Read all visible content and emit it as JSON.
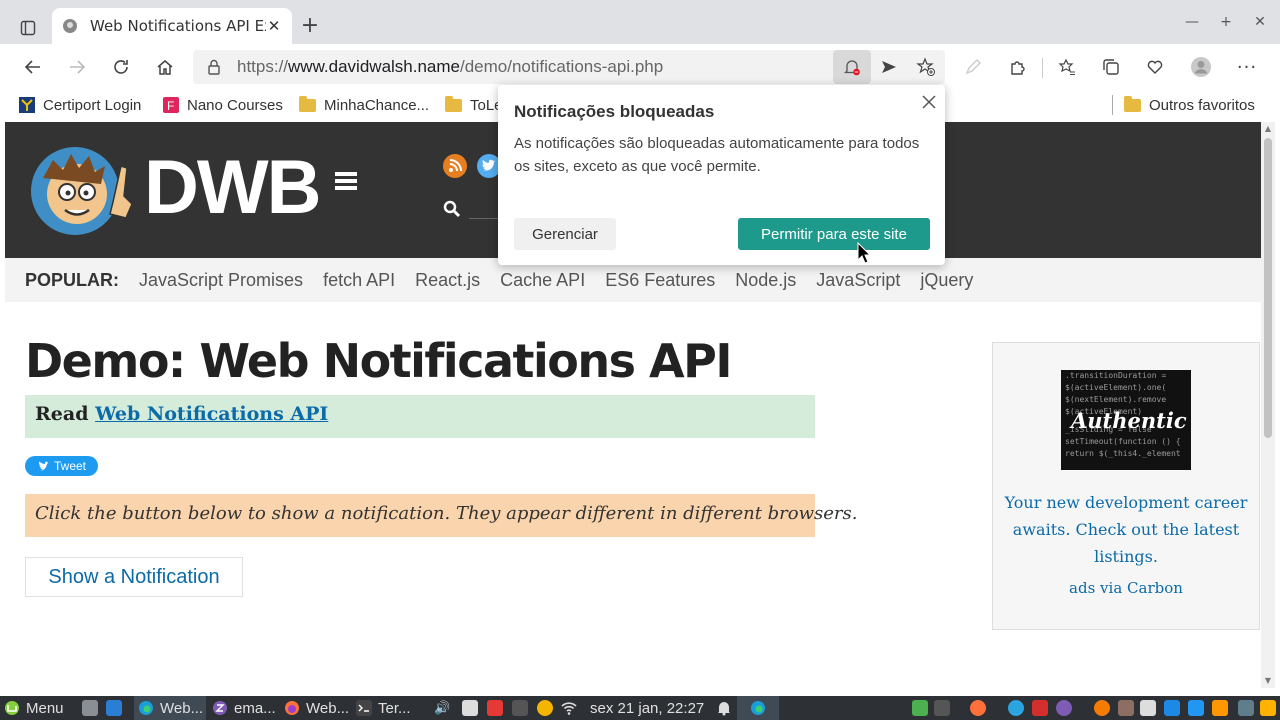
{
  "browser": {
    "tab_title": "Web Notifications API Ex",
    "url_scheme": "https://",
    "url_host": "www.davidwalsh.name",
    "url_path": "/demo/notifications-api.php",
    "bookmarks": [
      {
        "label": "Certiport Login",
        "icon": "certiport-icon"
      },
      {
        "label": "Nano Courses",
        "icon": "nano-courses-icon"
      },
      {
        "label": "MinhaChance...",
        "icon": "folder-icon"
      },
      {
        "label": "ToLe",
        "icon": "folder-icon"
      }
    ],
    "other_favorites": "Outros favoritos"
  },
  "popup": {
    "title": "Notificações bloqueadas",
    "body": "As notificações são bloqueadas automaticamente para todos os sites, exceto as que você permite.",
    "manage_label": "Gerenciar",
    "allow_label": "Permitir para este site"
  },
  "site": {
    "logo_text": "DWB",
    "popular_label": "POPULAR:",
    "popular_links": [
      "JavaScript Promises",
      "fetch API",
      "React.js",
      "Cache API",
      "ES6 Features",
      "Node.js",
      "JavaScript",
      "jQuery"
    ],
    "title": "Demo: Web Notifications API",
    "read_prefix": "Read",
    "read_link": "Web Notifications API",
    "tweet_label": "Tweet",
    "note": "Click the button below to show a notification. They appear different in different browsers.",
    "show_button": "Show a Notification",
    "ad": {
      "image_word": "Authentic",
      "text": "Your new development career awaits. Check out the latest listings.",
      "via": "ads via Carbon"
    }
  },
  "taskbar": {
    "menu_label": "Menu",
    "windows": [
      {
        "label": "Web...",
        "icon": "edge-icon"
      },
      {
        "label": "ema...",
        "icon": "emacs-icon"
      },
      {
        "label": "Web...",
        "icon": "firefox-icon"
      },
      {
        "label": "Ter...",
        "icon": "terminal-icon"
      }
    ],
    "clock": "sex 21 jan, 22:27"
  },
  "colors": {
    "accent": "#1d9a8c",
    "header_bg": "#333333",
    "link": "#0b6aa8",
    "read_bg": "#d4ecd9",
    "note_bg": "#fad4ad"
  }
}
